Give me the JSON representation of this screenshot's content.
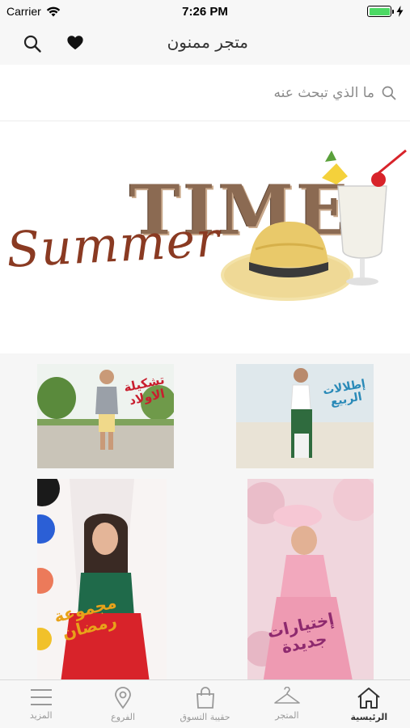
{
  "status_bar": {
    "carrier": "Carrier",
    "time": "7:26 PM",
    "battery_level": 1.0
  },
  "nav": {
    "title": "متجر ممنون",
    "search_icon": "search-icon",
    "favorites_icon": "heart-icon"
  },
  "search": {
    "placeholder": "ما الذي تبحث عنه",
    "icon": "search-icon"
  },
  "banner": {
    "headline": "TIME",
    "script_text": "Summer"
  },
  "tiles": [
    {
      "caption": "تشكيلة الاولاد",
      "color": "#c81e2e"
    },
    {
      "caption": "إطلالات الربيع",
      "color": "#2a8ab8"
    },
    {
      "caption": "مجموعة رمضان",
      "color": "#e8a21a"
    },
    {
      "caption": "إختيارات جديدة",
      "color": "#8e2a6e"
    }
  ],
  "tab_bar": {
    "items": [
      {
        "label": "المزيد",
        "icon": "menu-icon",
        "active": false
      },
      {
        "label": "الفروع",
        "icon": "location-pin-icon",
        "active": false
      },
      {
        "label": "حقيبة التسوق",
        "icon": "shopping-bag-icon",
        "active": false
      },
      {
        "label": "المتجر",
        "icon": "hanger-icon",
        "active": false
      },
      {
        "label": "الرئيسية",
        "icon": "home-icon",
        "active": true
      }
    ]
  },
  "colors": {
    "accent": "#333333",
    "inactive": "#999999",
    "battery": "#4cd964"
  }
}
